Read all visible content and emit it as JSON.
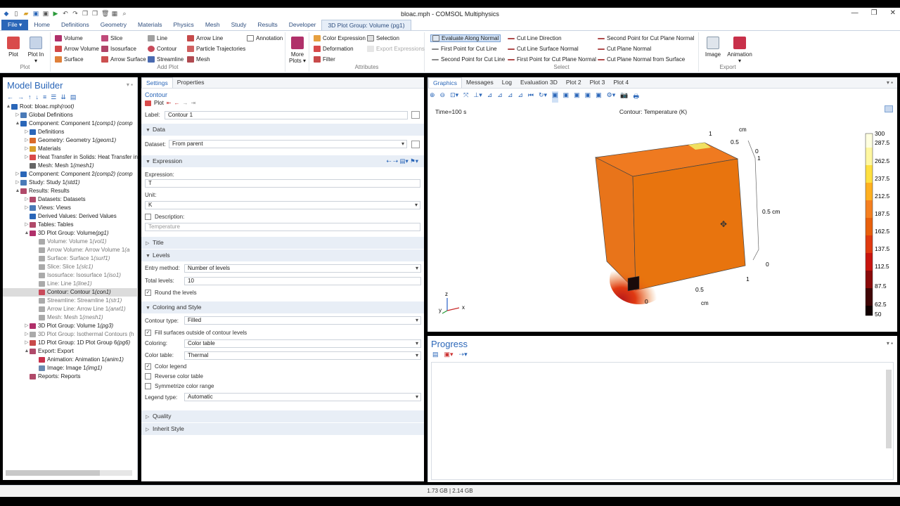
{
  "window": {
    "title": "bloac.mph - COMSOL Multiphysics"
  },
  "menus": [
    "Home",
    "Definitions",
    "Geometry",
    "Materials",
    "Physics",
    "Mesh",
    "Study",
    "Results",
    "Developer"
  ],
  "file_label": "File ▾",
  "context_tab": "3D Plot Group: Volume (pg1)",
  "ribbon": {
    "plot": "Plot",
    "plot_in": "Plot In ▾",
    "plot_group": "Plot",
    "add_plot": [
      "Volume",
      "Arrow Volume",
      "Surface",
      "Slice",
      "Isosurface",
      "Arrow Surface",
      "Line",
      "Contour",
      "Streamline",
      "Arrow Line",
      "Particle Trajectories",
      "Mesh",
      "Annotation"
    ],
    "add_plot_label": "Add Plot",
    "more_plots": "More Plots ▾",
    "attributes": [
      "Color Expression",
      "Deformation",
      "Filter",
      "Selection",
      "Export Expressions"
    ],
    "attributes_label": "Attributes",
    "select": [
      "Evaluate Along Normal",
      "First Point for Cut Line",
      "Second Point for Cut Line",
      "Cut Line Direction",
      "Cut Line Surface Normal",
      "First Point for Cut Plane Normal",
      "Second Point for Cut Plane Normal",
      "Cut Plane Normal",
      "Cut Plane Normal from Surface"
    ],
    "select_label": "Select",
    "export": [
      "Image",
      "Animation ▾"
    ],
    "export_label": "Export"
  },
  "model_builder": {
    "title": "Model Builder",
    "tree": [
      {
        "t": "Root: bloac.mph ",
        "i": "(root)"
      },
      {
        "t": "Global Definitions",
        "i": ""
      },
      {
        "t": "Component: Component 1 ",
        "i": "(comp1) (comp"
      },
      {
        "t": "Definitions",
        "i": ""
      },
      {
        "t": "Geometry: Geometry 1 ",
        "i": "(geom1)"
      },
      {
        "t": "Materials",
        "i": ""
      },
      {
        "t": "Heat Transfer in Solids: Heat Transfer in",
        "i": ""
      },
      {
        "t": "Mesh: Mesh 1 ",
        "i": "(mesh1)"
      },
      {
        "t": "Component: Component 2 ",
        "i": "(comp2) (comp"
      },
      {
        "t": "Study: Study 1 ",
        "i": "(std1)"
      },
      {
        "t": "Results: Results",
        "i": ""
      },
      {
        "t": "Datasets: Datasets",
        "i": ""
      },
      {
        "t": "Views: Views",
        "i": ""
      },
      {
        "t": "Derived Values: Derived Values",
        "i": ""
      },
      {
        "t": "Tables: Tables",
        "i": ""
      },
      {
        "t": "3D Plot Group: Volume ",
        "i": "(pg1)"
      },
      {
        "t": "Volume: Volume 1 ",
        "i": "(vol1)"
      },
      {
        "t": "Arrow Volume: Arrow Volume 1 ",
        "i": "(a"
      },
      {
        "t": "Surface: Surface 1 ",
        "i": "(surf1)"
      },
      {
        "t": "Slice: Slice 1 ",
        "i": "(slc1)"
      },
      {
        "t": "Isosurface: Isosurface 1 ",
        "i": "(iso1)"
      },
      {
        "t": "Line: Line 1 ",
        "i": "(line1)"
      },
      {
        "t": "Contour: Contour 1 ",
        "i": "(con1)"
      },
      {
        "t": "Streamline: Streamline 1 ",
        "i": "(str1)"
      },
      {
        "t": "Arrow Line: Arrow Line 1 ",
        "i": "(arwl1)"
      },
      {
        "t": "Mesh: Mesh 1 ",
        "i": "(mesh1)"
      },
      {
        "t": "3D Plot Group: Volume 1 ",
        "i": "(pg3)"
      },
      {
        "t": "3D Plot Group: Isothermal Contours (h",
        "i": ""
      },
      {
        "t": "1D Plot Group: 1D Plot Group 6 ",
        "i": "(pg6)"
      },
      {
        "t": "Export: Export",
        "i": ""
      },
      {
        "t": "Animation: Animation 1 ",
        "i": "(anim1)"
      },
      {
        "t": "Image: Image 1 ",
        "i": "(img1)"
      },
      {
        "t": "Reports: Reports",
        "i": ""
      }
    ]
  },
  "settings": {
    "tabs": [
      "Settings",
      "Properties"
    ],
    "node_type": "Contour",
    "plot_btn": "Plot",
    "label_caption": "Label:",
    "label_value": "Contour 1",
    "data_section": "Data",
    "dataset_caption": "Dataset:",
    "dataset_value": "From parent",
    "expression_section": "Expression",
    "expression_caption": "Expression:",
    "expression_value": "T",
    "unit_caption": "Unit:",
    "unit_value": "K",
    "description_caption": "Description:",
    "description_value": "Temperature",
    "title_section": "Title",
    "levels_section": "Levels",
    "entry_method_caption": "Entry method:",
    "entry_method_value": "Number of levels",
    "total_levels_caption": "Total levels:",
    "total_levels_value": "10",
    "round_levels": "Round the levels",
    "coloring_section": "Coloring and Style",
    "contour_type_caption": "Contour type:",
    "contour_type_value": "Filled",
    "fill_surfaces": "Fill surfaces outside of contour levels",
    "coloring_caption": "Coloring:",
    "coloring_value": "Color table",
    "color_table_caption": "Color table:",
    "color_table_value": "Thermal",
    "color_legend": "Color legend",
    "reverse_table": "Reverse color table",
    "symmetrize": "Symmetrize color range",
    "legend_type_caption": "Legend type:",
    "legend_type_value": "Automatic",
    "quality_section": "Quality",
    "inherit_section": "Inherit Style"
  },
  "graphics": {
    "tabs": [
      "Graphics",
      "Messages",
      "Log",
      "Evaluation 3D",
      "Plot 2",
      "Plot 3",
      "Plot 4"
    ],
    "time": "Time=100 s",
    "plot_title": "Contour: Temperature (K)",
    "axis_labels": [
      "1",
      "0.5",
      "0",
      "cm",
      "1",
      "0.5 cm",
      "0",
      "1",
      "0.5",
      "0",
      "cm"
    ],
    "triad": [
      "z",
      "y",
      "x"
    ],
    "legend": [
      "300",
      "287.5",
      "262.5",
      "237.5",
      "212.5",
      "187.5",
      "162.5",
      "137.5",
      "112.5",
      "87.5",
      "62.5",
      "50"
    ]
  },
  "progress": {
    "title": "Progress"
  },
  "status": {
    "memory": "1.73 GB | 2.14 GB"
  }
}
